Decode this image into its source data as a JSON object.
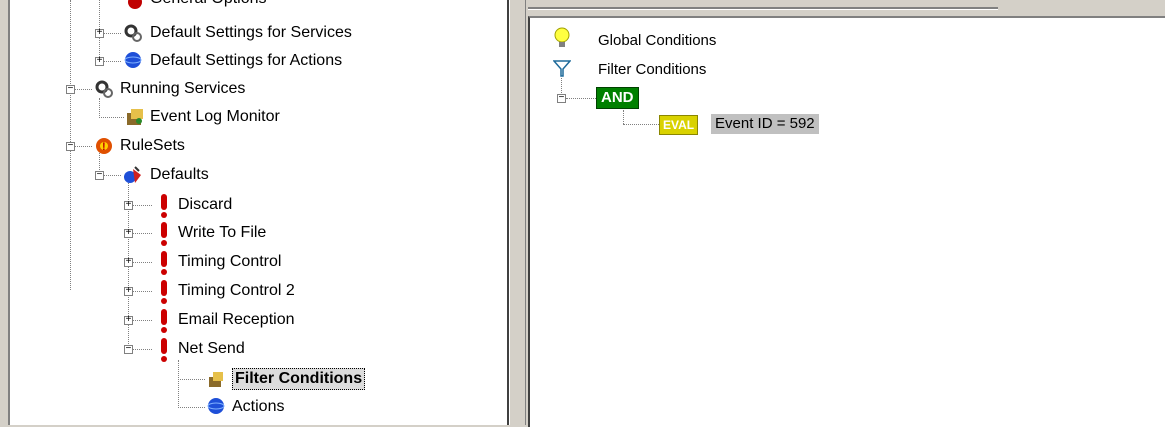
{
  "left_tree": {
    "partial_top_label": "General Options",
    "default_settings_services": "Default Settings for Services",
    "default_settings_actions": "Default Settings for Actions",
    "running_services": "Running Services",
    "event_log_monitor": "Event Log Monitor",
    "rulesets": "RuleSets",
    "defaults": "Defaults",
    "rules": [
      "Discard",
      "Write To File",
      "Timing Control",
      "Timing Control 2",
      "Email Reception",
      "Net Send"
    ],
    "filter_conditions": "Filter Conditions",
    "actions": "Actions"
  },
  "right_tree": {
    "global_conditions": "Global Conditions",
    "filter_conditions": "Filter Conditions",
    "and_operator": "AND",
    "eval_badge": "EVAL",
    "eval_expression": "Event ID = 592"
  },
  "colors": {
    "and_green": "#008000",
    "eval_yellow": "#d9d200",
    "rule_red": "#cc0000"
  }
}
